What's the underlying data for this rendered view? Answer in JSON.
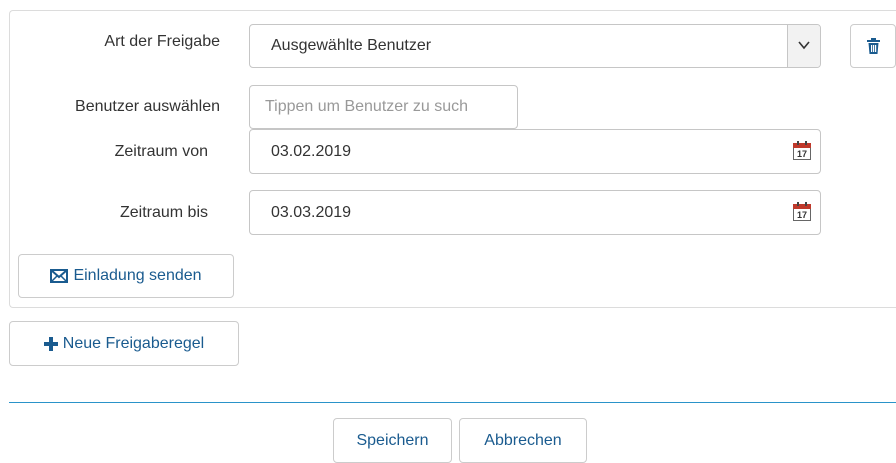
{
  "form": {
    "share_type": {
      "label": "Art der Freigabe",
      "value": "Ausgewählte Benutzer"
    },
    "user_select": {
      "label": "Benutzer auswählen",
      "placeholder": "Tippen um Benutzer zu such"
    },
    "date_from": {
      "label": "Zeitraum von",
      "value": "03.02.2019",
      "calendar_day": "17"
    },
    "date_to": {
      "label": "Zeitraum bis",
      "value": "03.03.2019",
      "calendar_day": "17"
    },
    "invite_button": {
      "label": "Einladung senden",
      "icon": "envelope-icon"
    },
    "delete_button": {
      "icon": "trash-icon"
    }
  },
  "new_rule_button": {
    "label": "Neue Freigaberegel",
    "icon": "plus-icon"
  },
  "footer": {
    "save_label": "Speichern",
    "cancel_label": "Abbrechen"
  },
  "colors": {
    "accent": "#1a5b8f",
    "separator": "#2a93c9",
    "calendar_red": "#c0392b"
  }
}
